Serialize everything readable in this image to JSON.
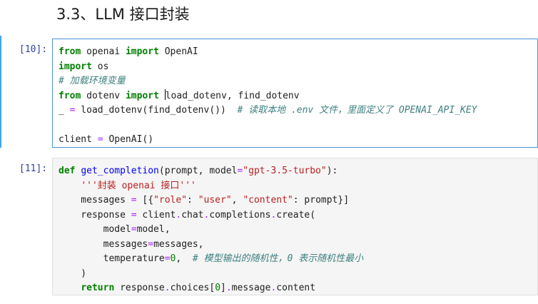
{
  "heading": "3.3、LLM 接口封装",
  "cells": [
    {
      "prompt": "[10]:",
      "lines": [
        [
          [
            "k",
            "from"
          ],
          [
            "t",
            " openai "
          ],
          [
            "k",
            "import"
          ],
          [
            "t",
            " OpenAI"
          ]
        ],
        [
          [
            "k",
            "import"
          ],
          [
            "t",
            " os"
          ]
        ],
        [
          [
            "c",
            "# 加载环境变量"
          ]
        ],
        [
          [
            "k",
            "from"
          ],
          [
            "t",
            " dotenv "
          ],
          [
            "k",
            "import"
          ],
          [
            "t",
            " "
          ],
          [
            "caret",
            ""
          ],
          [
            "t",
            "load_dotenv, find_dotenv"
          ]
        ],
        [
          [
            "t",
            "_ "
          ],
          [
            "o",
            "="
          ],
          [
            "t",
            " load_dotenv(find_dotenv())  "
          ],
          [
            "c",
            "# 读取本地 .env 文件，里面定义了 OPENAI_API_KEY"
          ]
        ],
        [],
        [
          [
            "t",
            "client "
          ],
          [
            "o",
            "="
          ],
          [
            "t",
            " OpenAI()"
          ]
        ]
      ]
    },
    {
      "prompt": "[11]:",
      "lines": [
        [
          [
            "k",
            "def"
          ],
          [
            "t",
            " "
          ],
          [
            "f",
            "get_completion"
          ],
          [
            "t",
            "(prompt, model"
          ],
          [
            "o",
            "="
          ],
          [
            "s",
            "\"gpt-3.5-turbo\""
          ],
          [
            "t",
            "):"
          ]
        ],
        [
          [
            "t",
            "    "
          ],
          [
            "s",
            "'''封装 openai 接口'''"
          ]
        ],
        [
          [
            "t",
            "    messages "
          ],
          [
            "o",
            "="
          ],
          [
            "t",
            " [{"
          ],
          [
            "s",
            "\"role\""
          ],
          [
            "t",
            ": "
          ],
          [
            "s",
            "\"user\""
          ],
          [
            "t",
            ", "
          ],
          [
            "s",
            "\"content\""
          ],
          [
            "t",
            ": prompt}]"
          ]
        ],
        [
          [
            "t",
            "    response "
          ],
          [
            "o",
            "="
          ],
          [
            "t",
            " client"
          ],
          [
            "o",
            "."
          ],
          [
            "t",
            "chat"
          ],
          [
            "o",
            "."
          ],
          [
            "t",
            "completions"
          ],
          [
            "o",
            "."
          ],
          [
            "t",
            "create("
          ]
        ],
        [
          [
            "t",
            "        model"
          ],
          [
            "o",
            "="
          ],
          [
            "t",
            "model,"
          ]
        ],
        [
          [
            "t",
            "        messages"
          ],
          [
            "o",
            "="
          ],
          [
            "t",
            "messages,"
          ]
        ],
        [
          [
            "t",
            "        temperature"
          ],
          [
            "o",
            "="
          ],
          [
            "n",
            "0"
          ],
          [
            "t",
            ",  "
          ],
          [
            "c",
            "# 模型输出的随机性，0 表示随机性最小"
          ]
        ],
        [
          [
            "t",
            "    )"
          ]
        ],
        [
          [
            "t",
            "    "
          ],
          [
            "k",
            "return"
          ],
          [
            "t",
            " response"
          ],
          [
            "o",
            "."
          ],
          [
            "t",
            "choices["
          ],
          [
            "n",
            "0"
          ],
          [
            "t",
            "]"
          ],
          [
            "o",
            "."
          ],
          [
            "t",
            "message"
          ],
          [
            "o",
            "."
          ],
          [
            "t",
            "content"
          ]
        ]
      ]
    }
  ]
}
